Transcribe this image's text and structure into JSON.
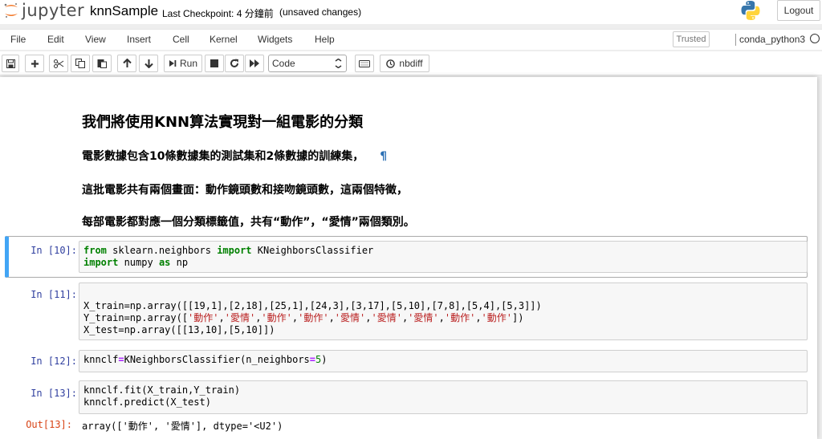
{
  "header": {
    "logo_text": "jupyter",
    "notebook_name": "knnSample",
    "checkpoint": "Last Checkpoint: 4 分鐘前",
    "status": "(unsaved changes)",
    "logout_label": "Logout"
  },
  "menubar": {
    "items": [
      "File",
      "Edit",
      "View",
      "Insert",
      "Cell",
      "Kernel",
      "Widgets",
      "Help"
    ],
    "trusted_label": "Trusted",
    "kernel_name": "conda_python3"
  },
  "toolbar": {
    "run_label": "Run",
    "cell_type": "Code",
    "nbdiff_label": "nbdiff"
  },
  "markdown": {
    "heading": "我們將使用KNN算法實現對一組電影的分類",
    "line1": "電影數據包含10條數據集的測試集和2條數據的訓練集，",
    "pilcrow": "¶",
    "line2": "這批電影共有兩個畫面：動作鏡頭數和接吻鏡頭數，這兩個特徵，",
    "line3": "每部電影都對應一個分類標籤值，共有“動作”，“愛情”兩個類別。"
  },
  "cells": {
    "c10": {
      "prompt": "In [10]:",
      "l1_kw1": "from",
      "l1_mid": " sklearn.neighbors ",
      "l1_kw2": "import",
      "l1_end": " KNeighborsClassifier",
      "l2_kw1": "import",
      "l2_mid": " numpy ",
      "l2_kw2": "as",
      "l2_end": " np"
    },
    "c11": {
      "prompt": "In [11]:",
      "line1": "X_train=np.array([[19,1],[2,18],[25,1],[24,3],[3,17],[5,10],[7,8],[5,4],[5,3]])",
      "y_prefix": "Y_train=np.array([",
      "y_labels": [
        "'動作'",
        "'愛情'",
        "'動作'",
        "'動作'",
        "'愛情'",
        "'愛情'",
        "'愛情'",
        "'動作'",
        "'動作'"
      ],
      "y_suffix": "])",
      "line3": "X_test=np.array([[13,10],[5,10]])"
    },
    "c12": {
      "prompt": "In [12]:",
      "pre": "knnclf",
      "mid": "KNeighborsClassifier(n_neighbors",
      "num": "5",
      "end": ")"
    },
    "c13": {
      "prompt": "In [13]:",
      "line1": "knnclf.fit(X_train,Y_train)",
      "line2": "knnclf.predict(X_test)",
      "out_prompt": "Out[13]:",
      "output": "array(['動作', '愛情'], dtype='<U2')"
    }
  }
}
